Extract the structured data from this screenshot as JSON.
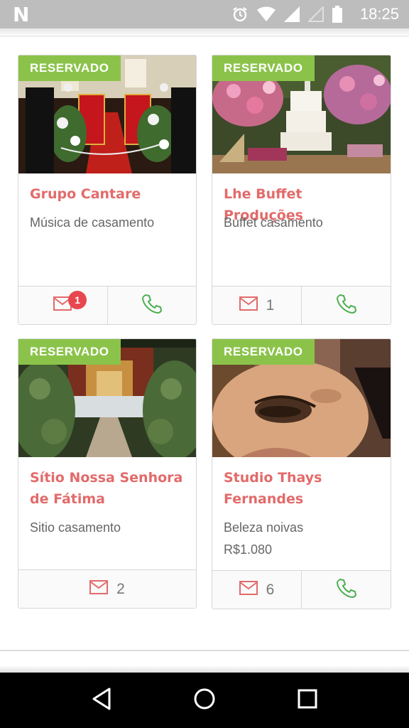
{
  "status_bar": {
    "logo": "N",
    "time": "18:25",
    "icons": [
      "alarm-icon",
      "wifi-icon",
      "signal-icon",
      "signal-empty-icon",
      "battery-icon"
    ]
  },
  "colors": {
    "accent_title": "#e36a6a",
    "badge_green": "#8bc34a",
    "icon_green": "#4caf50",
    "icon_red": "#e36a6a",
    "notif_red": "#e8474f"
  },
  "cards": [
    {
      "badge": "RESERVADO",
      "title": "Grupo Cantare",
      "subtitle": "Música de casamento",
      "photo": "wedding-ceremony-photo",
      "message_count": "",
      "notification": "1",
      "has_phone": true
    },
    {
      "badge": "RESERVADO",
      "title": "Lhe Buffet Produções",
      "subtitle": "Buffet casamento",
      "photo": "wedding-cake-buffet-photo",
      "message_count": "1",
      "has_phone": true
    },
    {
      "badge": "RESERVADO",
      "title": "Sítio Nossa Senhora de Fátima",
      "subtitle": "Sitio casamento",
      "photo": "venue-garden-photo",
      "message_count": "2",
      "has_phone": false
    },
    {
      "badge": "RESERVADO",
      "title": "Studio Thays Fernandes",
      "subtitle": "Beleza noivas",
      "price": "R$1.080",
      "photo": "bridal-makeup-photo",
      "message_count": "6",
      "has_phone": true
    }
  ],
  "nav_bar": {
    "buttons": [
      "back-icon",
      "home-icon",
      "recents-icon"
    ]
  }
}
